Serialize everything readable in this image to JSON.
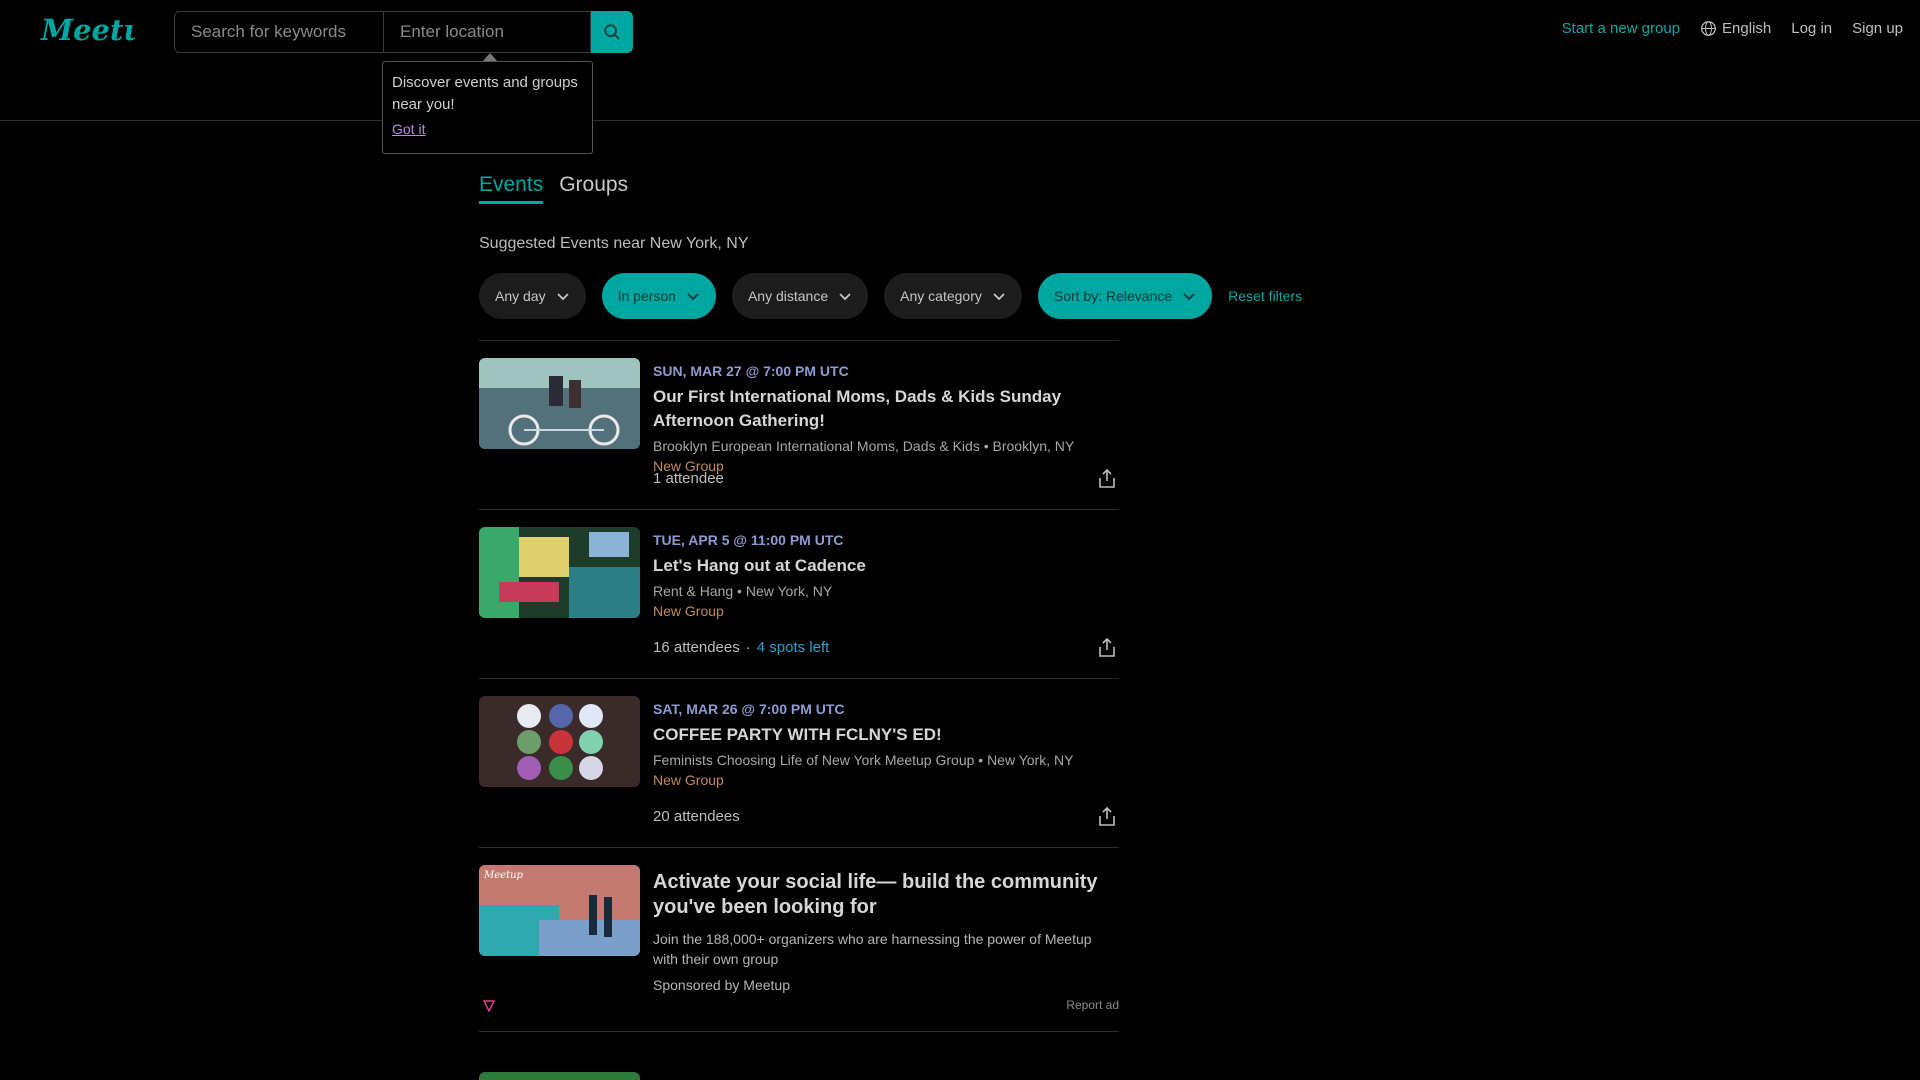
{
  "header": {
    "search_placeholder": "Search for keywords",
    "location_placeholder": "Enter location",
    "tooltip_text": "Discover events and groups near you!",
    "tooltip_link": "Got it",
    "nav": {
      "start_group": "Start a new group",
      "language": "English",
      "login": "Log in",
      "signup": "Sign up"
    }
  },
  "tabs": [
    {
      "label": "Events",
      "active": true
    },
    {
      "label": "Groups",
      "active": false
    }
  ],
  "suggested_text": "Suggested Events near New York, NY",
  "filters": {
    "day": "Any day",
    "type": "In person",
    "distance": "Any distance",
    "category": "Any category",
    "sort": "Sort by: Relevance",
    "reset": "Reset filters"
  },
  "events": [
    {
      "date": "SUN, MAR 27 @ 7:00 PM UTC",
      "title": "Our First International Moms, Dads & Kids Sunday Afternoon Gathering!",
      "group": "Brooklyn European International Moms, Dads & Kids • Brooklyn, NY",
      "badge": "New Group",
      "attendees": "1 attendee",
      "spots": ""
    },
    {
      "date": "TUE, APR 5 @ 11:00 PM UTC",
      "title": "Let's Hang out at Cadence",
      "group": "Rent & Hang • New York, NY",
      "badge": "New Group",
      "attendees": "16 attendees",
      "spots": "4 spots left"
    },
    {
      "date": "SAT, MAR 26 @ 7:00 PM UTC",
      "title": "COFFEE PARTY WITH FCLNY'S ED!",
      "group": "Feminists Choosing Life of New York Meetup Group • New York, NY",
      "badge": "New Group",
      "attendees": "20 attendees",
      "spots": ""
    }
  ],
  "ad": {
    "title": "Activate your social life— build the community you've been looking for",
    "description": "Join the 188,000+ organizers who are harnessing the power of Meetup with their own group",
    "sponsor": "Sponsored by Meetup",
    "report": "Report ad",
    "thumb_label": "Meetup"
  },
  "colors": {
    "accent": "#00a6a0",
    "date": "#8f9bd0",
    "badge": "#c08a5c",
    "spots": "#2aa0d6"
  },
  "logo_text": "Meetup"
}
